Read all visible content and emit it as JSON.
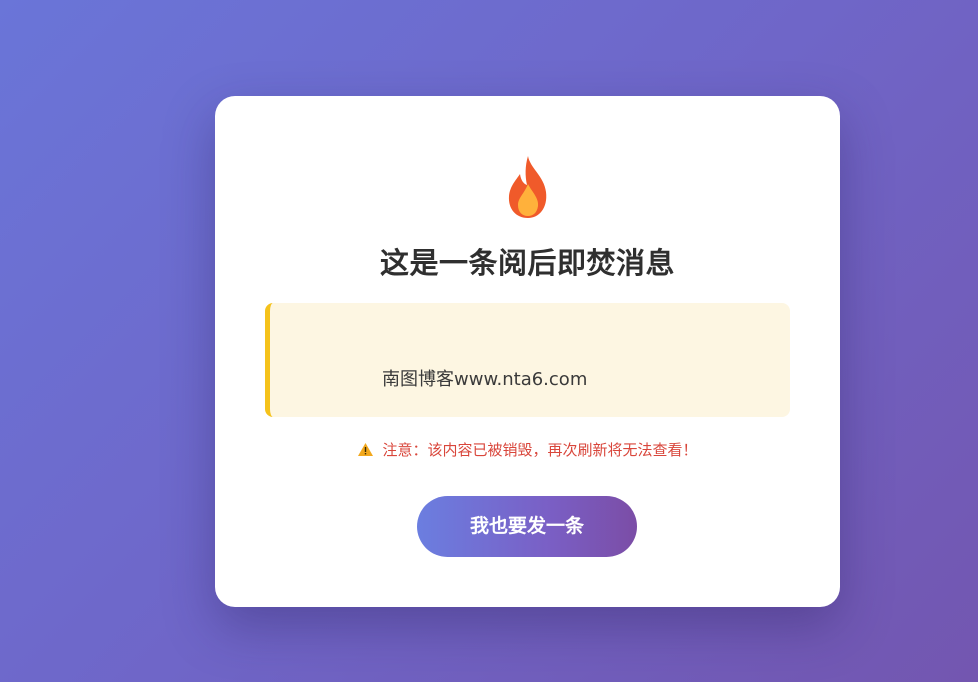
{
  "card": {
    "icon": "fire-icon",
    "title": "这是一条阅后即焚消息",
    "message": "南图博客www.nta6.com",
    "warning_icon": "warning-icon",
    "warning_text": "注意：该内容已被销毁，再次刷新将无法查看！",
    "button_label": "我也要发一条"
  },
  "colors": {
    "background_start": "#6a75d8",
    "background_end": "#7356b0",
    "card": "#ffffff",
    "message_bg": "#fdf6e2",
    "message_border": "#f5c21b",
    "warning_text": "#d9463b",
    "button_start": "#6b7ee0",
    "button_end": "#7b4da6"
  }
}
